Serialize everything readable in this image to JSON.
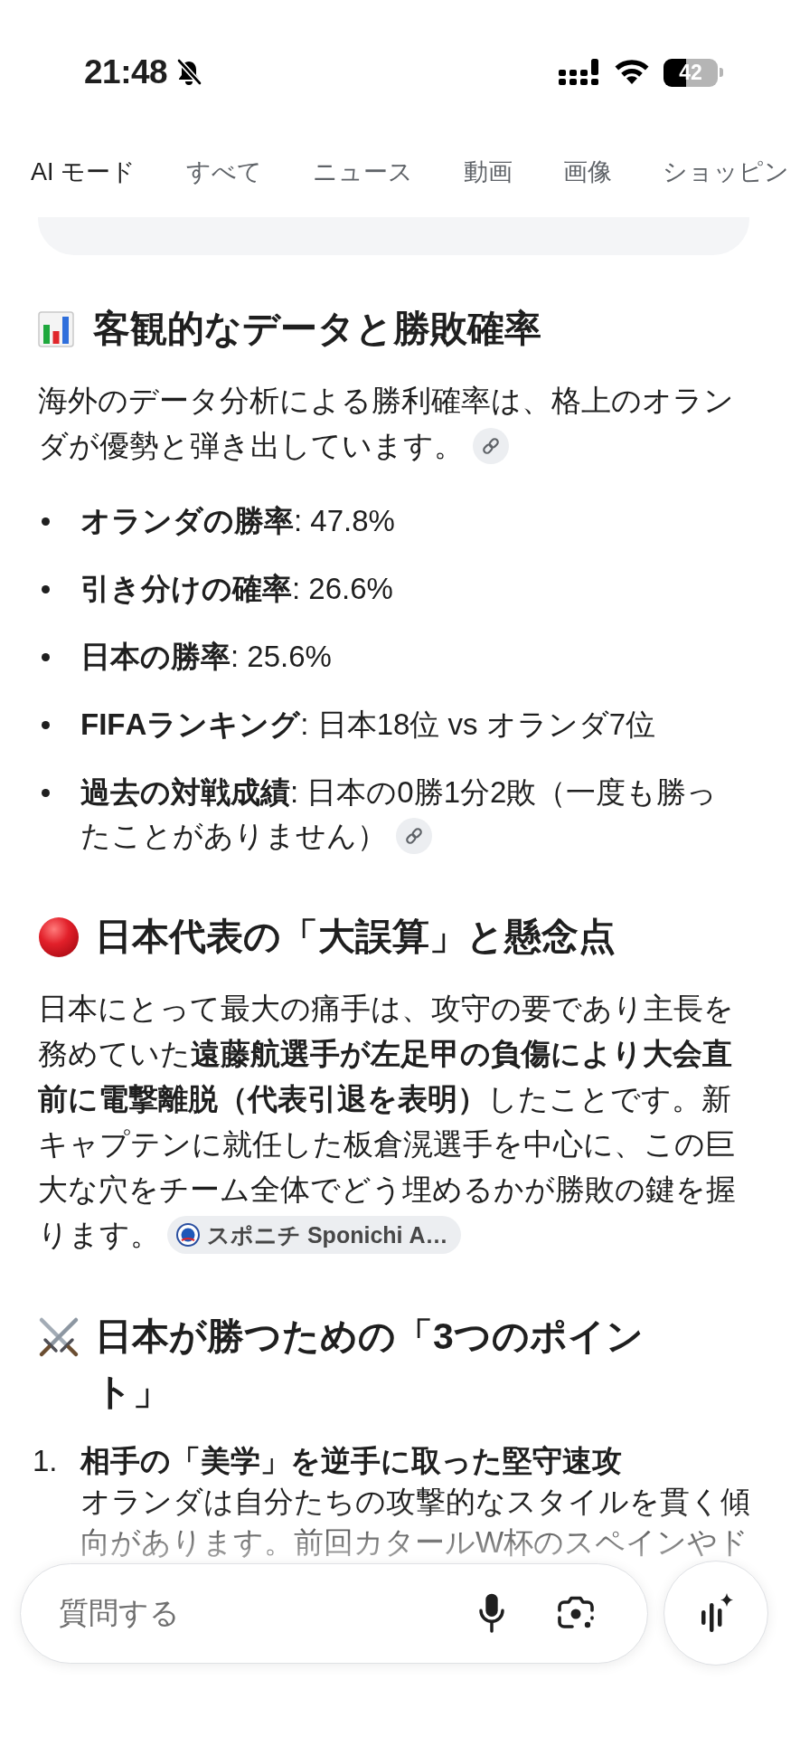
{
  "status_bar": {
    "time": "21:48",
    "battery": "42"
  },
  "tabs": [
    {
      "label": "AI モード",
      "selected": true
    },
    {
      "label": "すべて",
      "selected": false
    },
    {
      "label": "ニュース",
      "selected": false
    },
    {
      "label": "動画",
      "selected": false
    },
    {
      "label": "画像",
      "selected": false
    },
    {
      "label": "ショッピン",
      "selected": false
    }
  ],
  "sections": [
    {
      "kind": "chart",
      "heading": "客観的なデータと勝敗確率",
      "blocks": [
        {
          "kind": "paragraph",
          "text": "海外のデータ分析による勝利確率は、格上のオランダが優勢と弾き出しています。",
          "citation": {
            "kind": "link"
          }
        },
        {
          "kind": "bullets",
          "items": [
            {
              "text": "**オランダの勝率**: 47.8%"
            },
            {
              "text": "**引き分けの確率**: 26.6%"
            },
            {
              "text": "**日本の勝率**: 25.6%"
            },
            {
              "text": "**FIFAランキング**: 日本18位 vs オランダ7位"
            },
            {
              "text": "**過去の対戦成績**: 日本の0勝1分2敗（一度も勝ったことがありません）",
              "citation": {
                "kind": "link"
              }
            }
          ]
        }
      ]
    },
    {
      "kind": "alert",
      "heading": "日本代表の「大誤算」と懸念点",
      "blocks": [
        {
          "kind": "paragraph",
          "text": "日本にとって最大の痛手は、攻守の要であり主長を務めていた**遠藤航選手が左足甲の負傷により大会直前に電撃離脱（代表引退を表明）**したことです。新キャプテンに就任した板倉滉選手を中心に、この巨大な穴をチーム全体でどう埋めるかが勝敗の鍵を握ります。",
          "citation": {
            "kind": "source",
            "label": "スポニチ Sponichi A…"
          }
        }
      ]
    },
    {
      "kind": "battle",
      "heading": "日本が勝つための「3つのポイント」",
      "blocks": [
        {
          "kind": "numbered",
          "items": [
            {
              "number": "1.",
              "title": "相手の「美学」を逆手に取った堅守速攻",
              "body": "オランダは自分たちの攻撃的なスタイルを貫く傾向があります。前回カタールW杯のスペインやド"
            }
          ]
        }
      ]
    }
  ],
  "composer": {
    "placeholder": "質問する"
  }
}
